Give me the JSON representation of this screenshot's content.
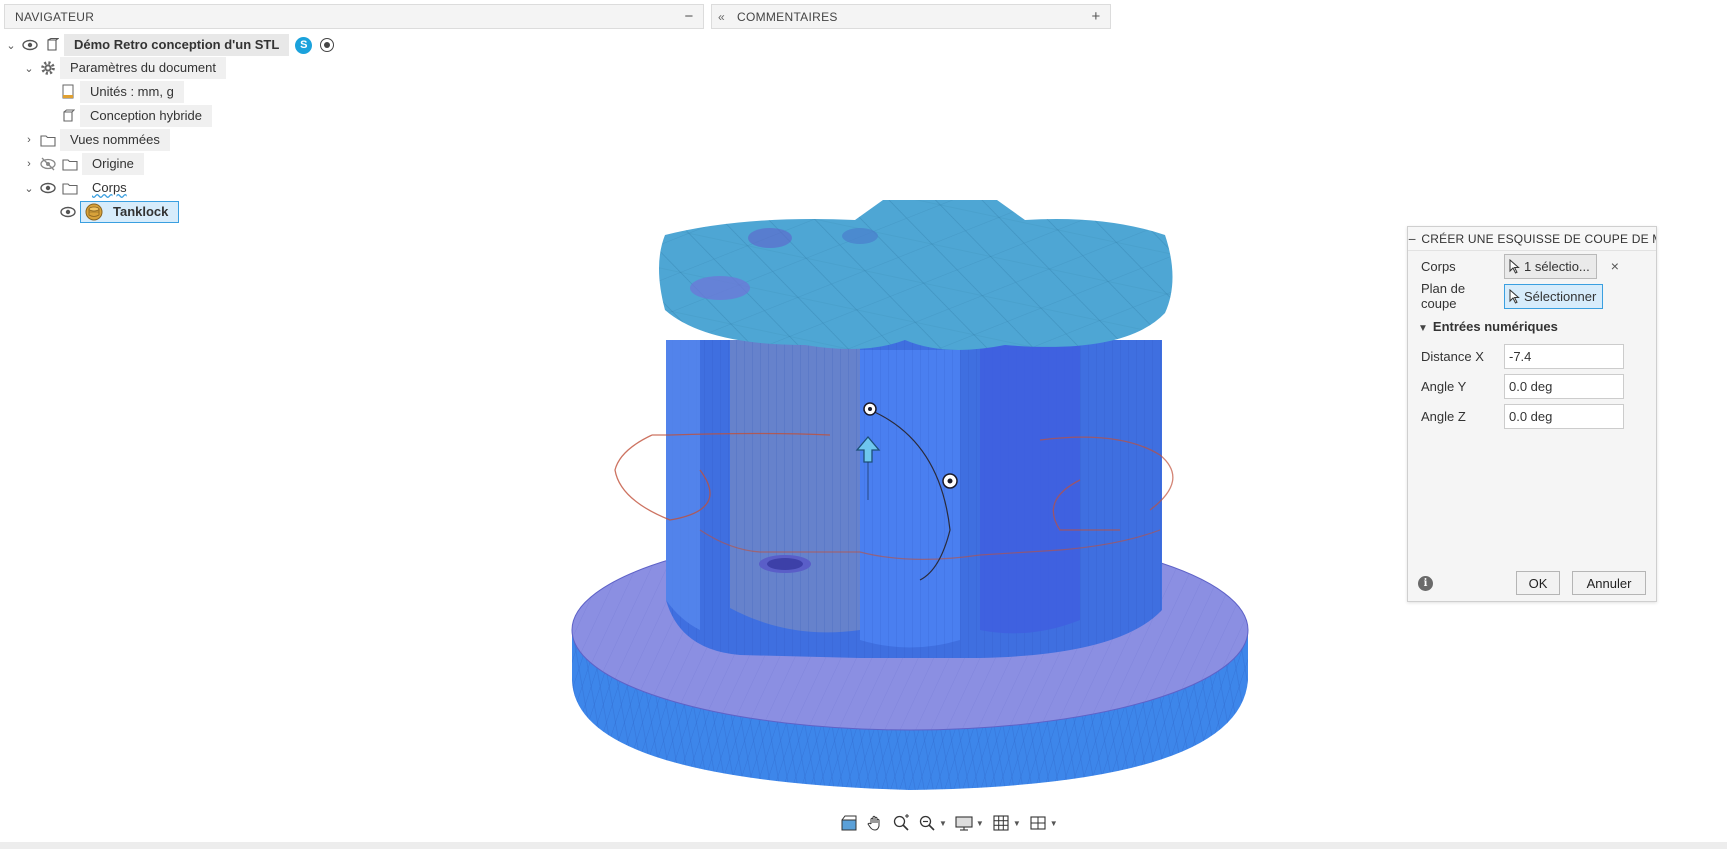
{
  "navigator": {
    "title": "NAVIGATEUR",
    "minimize_symbol": "−",
    "tree": {
      "root_label": "Démo Retro conception d'un STL",
      "root_badge": "S",
      "doc_settings": "Paramètres du document",
      "units": "Unités : mm, g",
      "hybrid_design": "Conception hybride",
      "named_views": "Vues nommées",
      "origin": "Origine",
      "bodies": "Corps",
      "body_item": "Tanklock"
    }
  },
  "comments": {
    "title": "COMMENTAIRES",
    "collapse_symbol": "«",
    "add_symbol": "+"
  },
  "dialog": {
    "title": "CRÉER UNE ESQUISSE DE COUPE DE MA",
    "minimize_symbol": "−",
    "body_label": "Corps",
    "body_value": "1 sélectio...",
    "clear_symbol": "×",
    "plane_label": "Plan de coupe",
    "plane_value": "Sélectionner",
    "section_title": "Entrées numériques",
    "distance_x_label": "Distance X",
    "distance_x_value": "-7.4",
    "angle_y_label": "Angle Y",
    "angle_y_value": "0.0 deg",
    "angle_z_label": "Angle Z",
    "angle_z_value": "0.0 deg",
    "info_symbol": "i",
    "ok_label": "OK",
    "cancel_label": "Annuler"
  },
  "toolbar": {
    "icons": [
      "grid-orbit-icon",
      "pan-icon",
      "zoom-window-icon",
      "zoom-icon",
      "display-icon",
      "grid-icon",
      "viewports-icon"
    ]
  },
  "colors": {
    "accent": "#3a9fe0",
    "model_top": "#4aa0d0",
    "model_side": "#3f7fe6",
    "model_base_top": "#8c8ee0",
    "selection_bg": "#d7ecfb"
  }
}
